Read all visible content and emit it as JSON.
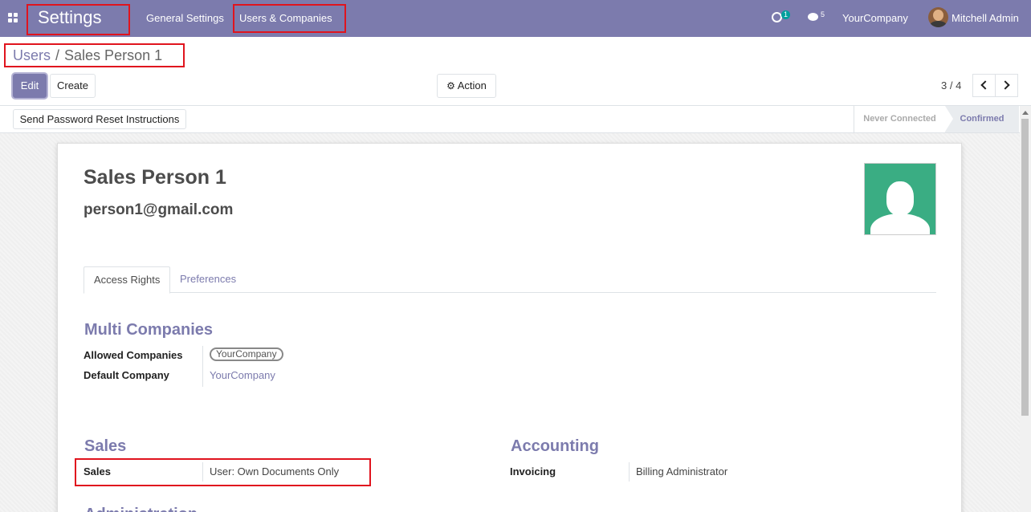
{
  "navbar": {
    "app_title": "Settings",
    "menu": [
      "General Settings",
      "Users & Companies"
    ],
    "activity_count": "1",
    "messages_count": "5",
    "company": "YourCompany",
    "user": "Mitchell Admin"
  },
  "breadcrumb": {
    "parent": "Users",
    "separator": "/",
    "current": "Sales Person 1"
  },
  "buttons": {
    "edit": "Edit",
    "create": "Create",
    "action": "Action",
    "reset_password": "Send Password Reset Instructions"
  },
  "pager": {
    "value": "3 / 4"
  },
  "status": {
    "stages": [
      "Never Connected",
      "Confirmed"
    ],
    "current": "Confirmed"
  },
  "record": {
    "name": "Sales Person 1",
    "login": "person1@gmail.com"
  },
  "tabs": [
    "Access Rights",
    "Preferences"
  ],
  "sections": {
    "multi_companies": {
      "title": "Multi Companies",
      "allowed_label": "Allowed Companies",
      "allowed_value": "YourCompany",
      "default_label": "Default Company",
      "default_value": "YourCompany"
    },
    "sales": {
      "title": "Sales",
      "label": "Sales",
      "value": "User: Own Documents Only"
    },
    "accounting": {
      "title": "Accounting",
      "label": "Invoicing",
      "value": "Billing Administrator"
    },
    "administration": {
      "title": "Administration"
    }
  },
  "colors": {
    "brand": "#7c7bad",
    "highlight": "#e0141e",
    "avatar_bg": "#3aad83"
  }
}
